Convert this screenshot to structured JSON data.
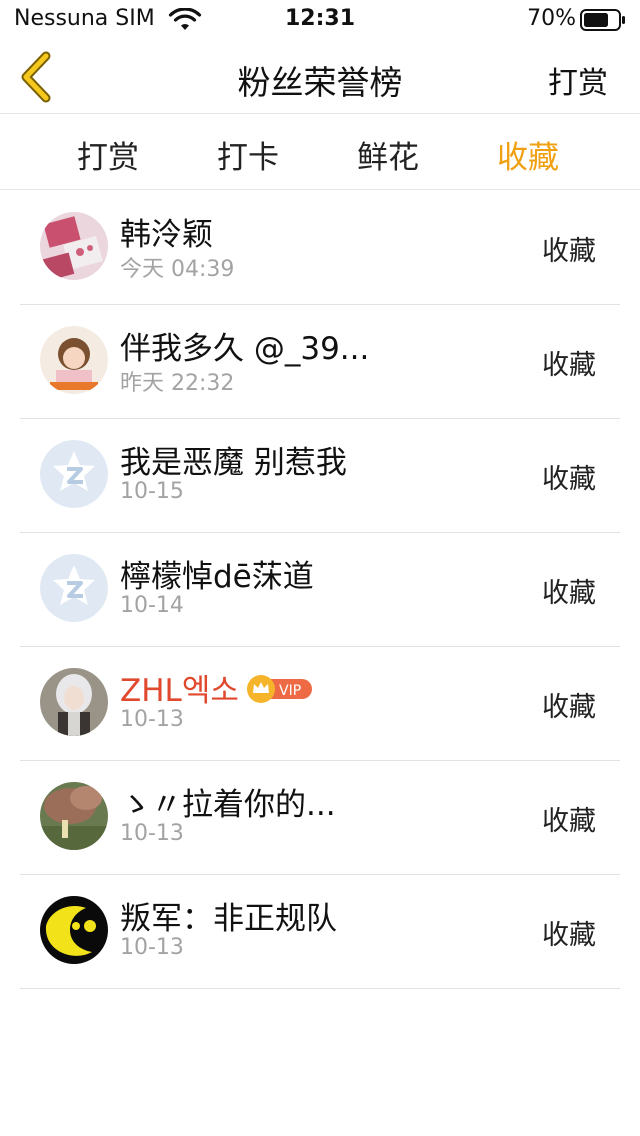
{
  "status_bar": {
    "carrier": "Nessuna SIM",
    "time": "12:31",
    "battery": "70%"
  },
  "nav": {
    "title": "粉丝荣誉榜",
    "right_button": "打赏",
    "back_icon": "chevron-left-icon"
  },
  "tabs": [
    {
      "label": "打赏",
      "active": false
    },
    {
      "label": "打卡",
      "active": false
    },
    {
      "label": "鲜花",
      "active": false
    },
    {
      "label": "收藏",
      "active": true
    }
  ],
  "colors": {
    "accent": "#f0a010",
    "vip_name": "#e0492d",
    "subtext": "#a3a3a3"
  },
  "fans": [
    {
      "name": "韩泠颖",
      "time": "今天 04:39",
      "action": "收藏",
      "vip": false
    },
    {
      "name": "伴我多久 @_39...",
      "time": "昨天 22:32",
      "action": "收藏",
      "vip": false
    },
    {
      "name": "我是恶魔 别惹我",
      "time": "10-15",
      "action": "收藏",
      "vip": false
    },
    {
      "name": "檸檬悼dē莯道",
      "time": "10-14",
      "action": "收藏",
      "vip": false
    },
    {
      "name": "ZHL엑소",
      "time": "10-13",
      "action": "收藏",
      "vip": true,
      "vip_label": "VIP"
    },
    {
      "name": "ゝ〃拉着你的...",
      "time": "10-13",
      "action": "收藏",
      "vip": false
    },
    {
      "name": "叛军：非正规队",
      "time": "10-13",
      "action": "收藏",
      "vip": false
    }
  ]
}
